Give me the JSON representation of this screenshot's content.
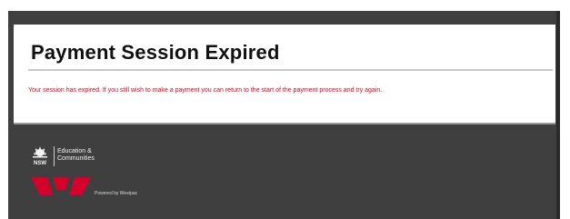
{
  "page": {
    "title": "Payment Session Expired",
    "message": "Your session has expired. If you still wish to make a payment you can return to the start of the payment process and try again."
  },
  "footer": {
    "nsw_label": "NSW",
    "education_line1": "Education &",
    "education_line2": "Communities",
    "powered_by": "Powered by Westpac"
  },
  "colors": {
    "message_text": "#e0001b",
    "westpac_red": "#d5002b",
    "footer_background": "#3f3f3f"
  }
}
